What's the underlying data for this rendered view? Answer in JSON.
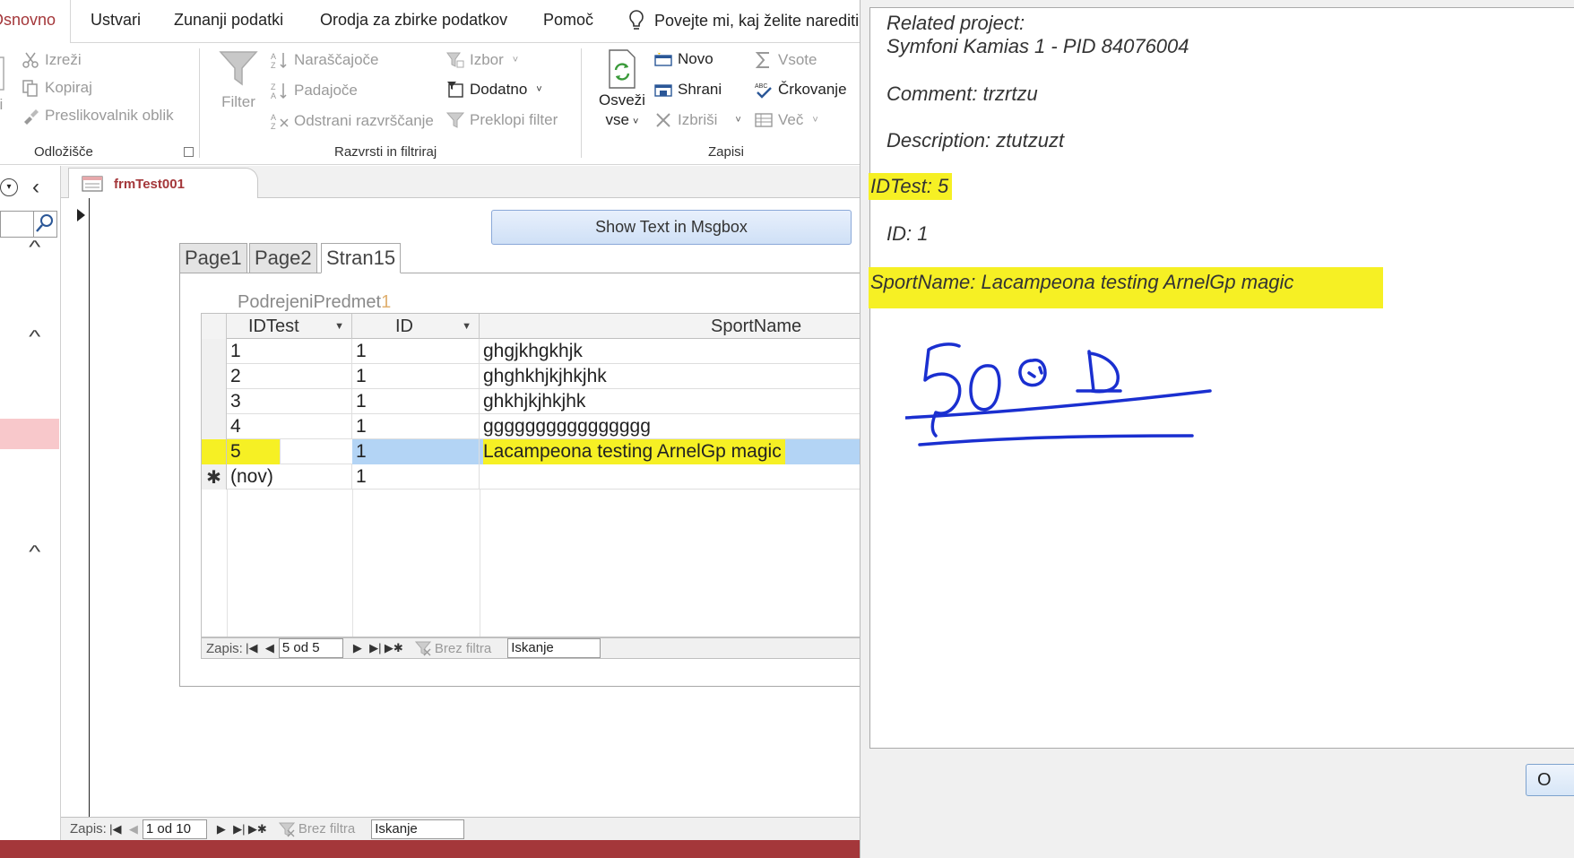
{
  "ribbon_tabs": {
    "home": "Osnovno",
    "create": "Ustvari",
    "external": "Zunanji podatki",
    "dbtools": "Orodja za zbirke podatkov",
    "help": "Pomoč",
    "tell_me": "Povejte mi, kaj želite narediti"
  },
  "clipboard": {
    "cut": "Izreži",
    "copy": "Kopiraj",
    "format_painter": "Preslikovalnik oblik",
    "label": "Odložišče"
  },
  "sort_filter": {
    "filter": "Filter",
    "ascending": "Naraščajoče",
    "descending": "Padajoče",
    "remove_sort": "Odstrani razvrščanje",
    "selection": "Izbor",
    "advanced": "Dodatno",
    "toggle_filter": "Preklopi filter",
    "label": "Razvrsti in filtriraj"
  },
  "records": {
    "refresh_line1": "Osveži",
    "refresh_line2": "vse",
    "new": "Novo",
    "save": "Shrani",
    "delete": "Izbriši",
    "totals": "Vsote",
    "spelling": "Črkovanje",
    "more": "Več",
    "label": "Zapisi"
  },
  "document": {
    "tab_name": "frmTest001"
  },
  "form": {
    "button_label": "Show Text in Msgbox",
    "tabs": [
      "Page1",
      "Page2",
      "Stran15"
    ],
    "subform_label": "PodrejeniPredmet",
    "subform_label_suffix": "1"
  },
  "datasheet": {
    "columns": [
      "IDTest",
      "ID",
      "SportName"
    ],
    "rows": [
      {
        "idtest": "1",
        "id": "1",
        "sport": "ghgjkhgkhjk"
      },
      {
        "idtest": "2",
        "id": "1",
        "sport": "ghghkhjkjhkjhk"
      },
      {
        "idtest": "3",
        "id": "1",
        "sport": "ghkhjkjhkjhk"
      },
      {
        "idtest": "4",
        "id": "1",
        "sport": "gggggggggggggggg"
      },
      {
        "idtest": "5",
        "id": "1",
        "sport": "Lacampeona testing ArnelGp magic"
      },
      {
        "idtest": "(nov)",
        "id": "1",
        "sport": ""
      }
    ],
    "new_row_marker": "✱"
  },
  "sub_nav": {
    "label": "Zapis:",
    "position": "5 od 5",
    "no_filter": "Brez filtra",
    "search": "Iskanje"
  },
  "main_nav": {
    "label": "Zapis:",
    "position": "1 od 10",
    "no_filter": "Brez filtra",
    "search": "Iskanje"
  },
  "msgbox": {
    "related_label": "Related project:",
    "related_value": "Symfoni Kamias 1 - PID 84076004",
    "comment": "Comment: trzrtzu",
    "description": "Description: ztutzuzt",
    "idtest": "IDTest: 5",
    "id": "ID: 1",
    "sportname": "SportName: Lacampeona testing ArnelGp magic",
    "ok_label": "O"
  },
  "colors": {
    "access_red": "#a4373a",
    "highlight_yellow": "#f6f024",
    "selection_blue": "#b3d4f5",
    "ink_blue": "#1a2fd0"
  }
}
